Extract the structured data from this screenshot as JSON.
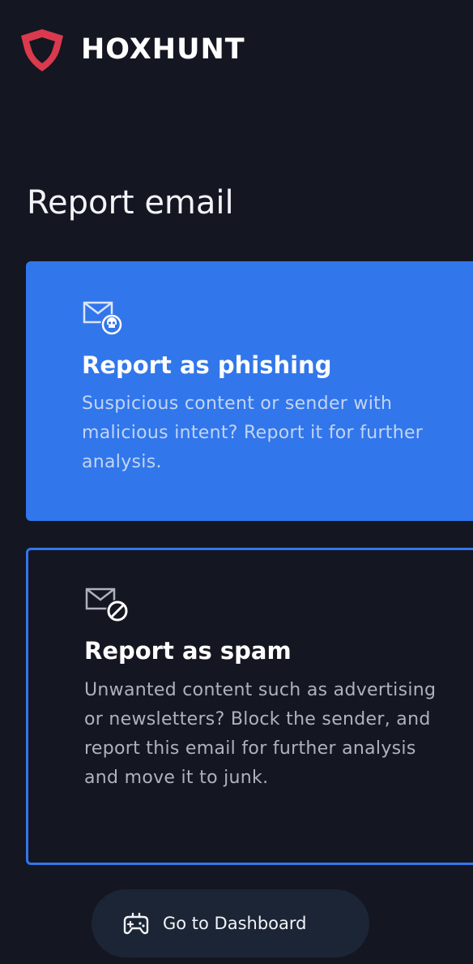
{
  "brand": {
    "name": "HOXHUNT",
    "logo_icon": "shield-icon",
    "logo_color": "#d93a4e"
  },
  "page": {
    "title": "Report email"
  },
  "options": {
    "phishing": {
      "icon": "mail-skull-icon",
      "title": "Report as phishing",
      "description": "Suspicious content or sender with malicious intent? Report it for further analysis."
    },
    "spam": {
      "icon": "mail-block-icon",
      "title": "Report as spam",
      "description": "Unwanted content such as advertising or newsletters? Block the sender, and report this email for further analysis and move it to junk."
    }
  },
  "actions": {
    "dashboard": {
      "icon": "gamepad-icon",
      "label": "Go to Dashboard"
    }
  },
  "colors": {
    "background": "#141621",
    "accent": "#3176ea",
    "button_bg": "#1c2535"
  }
}
